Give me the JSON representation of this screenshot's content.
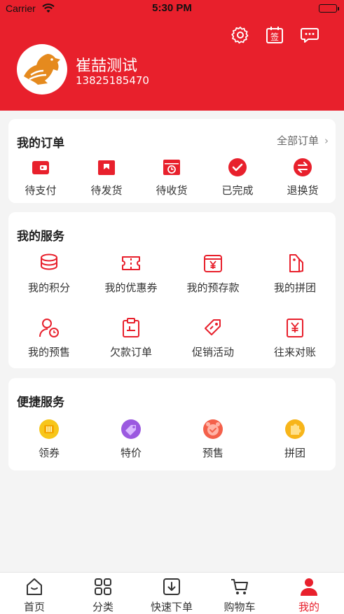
{
  "status_bar": {
    "carrier": "Carrier",
    "time": "5:30 PM"
  },
  "header": {
    "user_name": "崔喆测试",
    "user_phone": "13825185470",
    "icons": [
      "gear-icon",
      "sign-in-calendar-icon",
      "message-icon"
    ],
    "sign_glyph": "签"
  },
  "orders": {
    "title": "我的订单",
    "all_link": "全部订单",
    "chevron": "›",
    "items": [
      {
        "label": "待支付",
        "icon": "wallet-icon"
      },
      {
        "label": "待发货",
        "icon": "package-icon"
      },
      {
        "label": "待收货",
        "icon": "delivery-clock-icon"
      },
      {
        "label": "已完成",
        "icon": "check-circle-icon"
      },
      {
        "label": "退换货",
        "icon": "exchange-icon"
      }
    ]
  },
  "services": {
    "title": "我的服务",
    "items": [
      {
        "label": "我的积分",
        "icon": "points-coins-icon"
      },
      {
        "label": "我的优惠券",
        "icon": "coupon-icon"
      },
      {
        "label": "我的预存款",
        "icon": "deposit-yen-icon"
      },
      {
        "label": "我的拼团",
        "icon": "group-tag-icon"
      },
      {
        "label": "我的预售",
        "icon": "presale-user-clock-icon"
      },
      {
        "label": "欠款订单",
        "icon": "debt-clipboard-icon"
      },
      {
        "label": "促销活动",
        "icon": "promo-tag-icon"
      },
      {
        "label": "往来对账",
        "icon": "reconcile-yen-icon"
      }
    ]
  },
  "quick": {
    "title": "便捷服务",
    "items": [
      {
        "label": "领券",
        "icon": "coupon-badge-icon",
        "color": "#f5b800"
      },
      {
        "label": "特价",
        "icon": "special-price-icon",
        "color": "#8e44d6"
      },
      {
        "label": "预售",
        "icon": "presale-alarm-icon",
        "color": "#f0503c"
      },
      {
        "label": "拼团",
        "icon": "group-puzzle-icon",
        "color": "#f5a800"
      }
    ]
  },
  "tabbar": {
    "items": [
      {
        "label": "首页",
        "icon": "home-icon"
      },
      {
        "label": "分类",
        "icon": "category-grid-icon"
      },
      {
        "label": "快速下单",
        "icon": "quick-order-icon"
      },
      {
        "label": "购物车",
        "icon": "cart-icon"
      },
      {
        "label": "我的",
        "icon": "profile-icon",
        "active": true
      }
    ]
  },
  "colors": {
    "brand_red": "#e8202c",
    "background": "#f4f4f4"
  }
}
